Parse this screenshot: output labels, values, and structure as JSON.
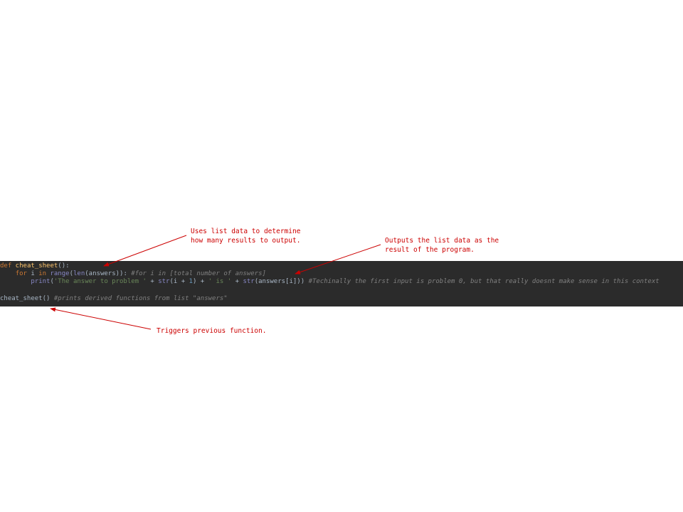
{
  "code": {
    "line1": {
      "kw_def": "def",
      "fn_name": " cheat_sheet",
      "punct": "():"
    },
    "line2": {
      "indent": "    ",
      "kw_for": "for",
      "var_i": " i ",
      "kw_in": "in",
      "sp": " ",
      "bi_range": "range",
      "p1": "(",
      "bi_len": "len",
      "p2": "(answers)):",
      "comment": " #for i in [total number of answers]"
    },
    "line3": {
      "indent": "        ",
      "bi_print": "print",
      "p1": "(",
      "str1": "'The answer to problem '",
      "op1": " + ",
      "bi_str1": "str",
      "p2": "(i + ",
      "num1": "1",
      "p3": ") + ",
      "str2": "' is '",
      "op2": " + ",
      "bi_str2": "str",
      "p4": "(answers[i]))",
      "comment": " #Techinally the first input is problem 0, but that really doesnt make sense in this context"
    },
    "line5": {
      "call": "cheat_sheet()",
      "comment": " #prints derived functions from list \"answers\""
    }
  },
  "annotations": {
    "list_length": "Uses list data to determine\nhow many results to output.",
    "output": "Outputs the list data as the\nresult of the program.",
    "trigger": "Triggers previous function."
  },
  "colors": {
    "annotation": "#cc0000",
    "panel_bg": "#2b2b2b"
  }
}
